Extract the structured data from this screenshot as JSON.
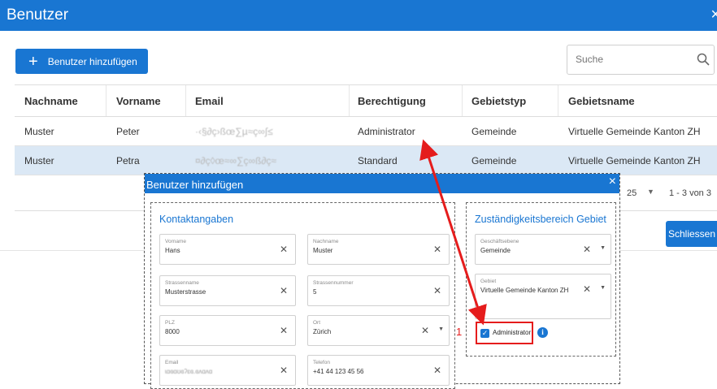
{
  "window": {
    "title": "Benutzer",
    "close_glyph": "×"
  },
  "toolbar": {
    "add_user_label": "Benutzer hinzufügen",
    "add_user_icon": "plus-icon",
    "search": {
      "placeholder": "Suche",
      "value": "",
      "icon": "search-icon"
    }
  },
  "table": {
    "columns": [
      "Nachname",
      "Vorname",
      "Email",
      "Berechtigung",
      "Gebietstyp",
      "Gebietsname"
    ],
    "rows": [
      {
        "nachname": "Muster",
        "vorname": "Peter",
        "email": "·‹§∂ç›ßœ∑µ≈ç∞∫≤",
        "berechtigung": "Administrator",
        "gebietstyp": "Gemeinde",
        "gebietsname": "Virtuelle Gemeinde Kanton ZH",
        "selected": false
      },
      {
        "nachname": "Muster",
        "vorname": "Petra",
        "email": "¤∂ç◊œ≈∞∑ç∞ß∂ç≈",
        "berechtigung": "Standard",
        "gebietstyp": "Gemeinde",
        "gebietsname": "Virtuelle Gemeinde Kanton ZH",
        "selected": true
      }
    ],
    "footer": {
      "page_size": "25",
      "range": "1 - 3 von 3"
    }
  },
  "close_button": {
    "label": "Schliessen"
  },
  "subdialog": {
    "title": "Benutzer hinzufügen",
    "close_glyph": "×",
    "contact": {
      "heading": "Kontaktangaben",
      "fields": {
        "vorname": {
          "label": "Vorname",
          "value": "Hans"
        },
        "nachname": {
          "label": "Nachname",
          "value": "Muster"
        },
        "strassenname": {
          "label": "Strassenname",
          "value": "Musterstrasse"
        },
        "strassennummer": {
          "label": "Strassennummer",
          "value": "5"
        },
        "plz": {
          "label": "PLZ",
          "value": "8000"
        },
        "ort": {
          "label": "Ort",
          "value": "Zürich"
        },
        "email": {
          "label": "Email",
          "value": "ɩɑɞɑʊɞʔɛɞ.ɞʌɑʌɑ"
        },
        "telefon": {
          "label": "Telefon",
          "value": "+41 44 123 45 56"
        }
      }
    },
    "area": {
      "heading": "Zuständigkeitsbereich Gebiet",
      "geschaeftsebene": {
        "label": "Geschäftsebene",
        "value": "Gemeinde"
      },
      "gebiet": {
        "label": "Gebiet",
        "value": "Virtuelle Gemeinde Kanton ZH"
      },
      "administrator": {
        "label": "Administrator",
        "checked": true
      }
    }
  },
  "annotation": {
    "marker": "1",
    "color": "#e51c1c"
  },
  "colors": {
    "primary": "#1976d2",
    "selected_row": "#dbe8f5",
    "annotation": "#e51c1c"
  }
}
